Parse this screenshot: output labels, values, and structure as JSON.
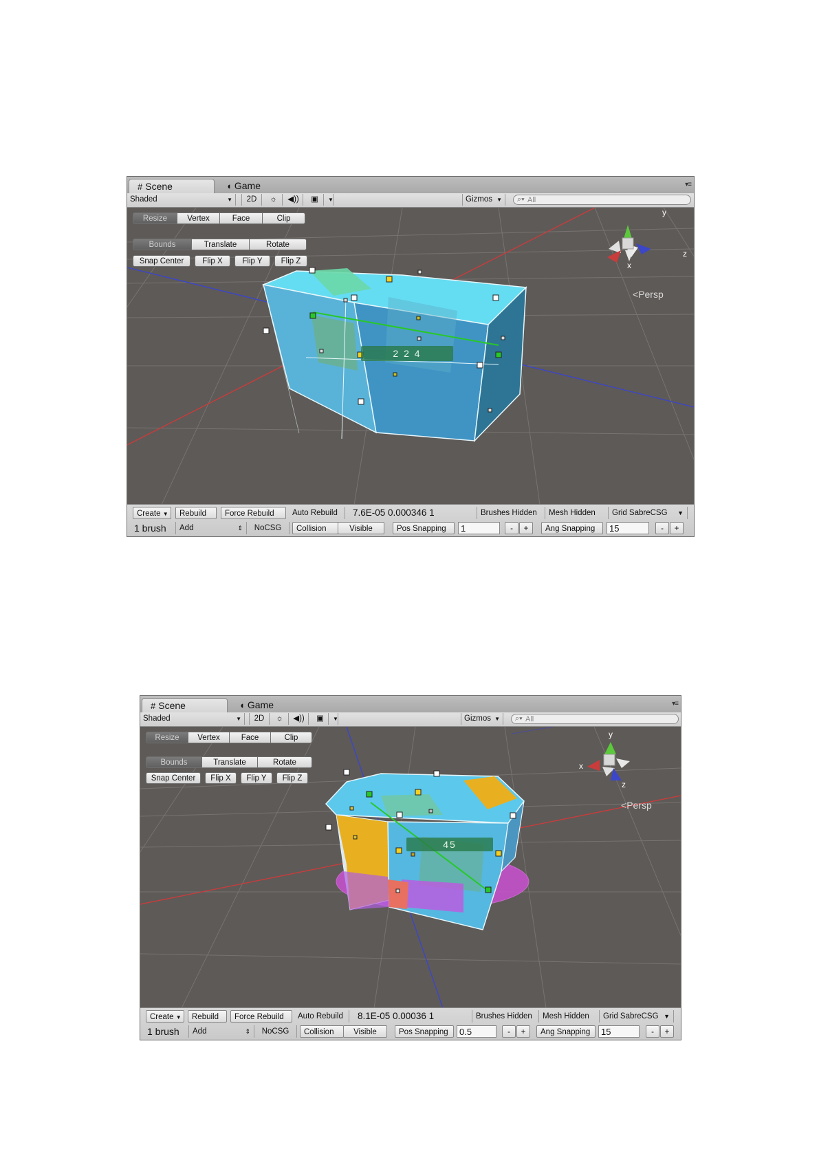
{
  "panels": [
    {
      "tabs": {
        "scene": "Scene",
        "game": "Game"
      },
      "toolbar": {
        "shading": "Shaded",
        "mode2d": "2D",
        "gizmos": "Gizmos",
        "search_placeholder": "All"
      },
      "modes": [
        "Resize",
        "Vertex",
        "Face",
        "Clip"
      ],
      "resize_modes": [
        "Bounds",
        "Translate",
        "Rotate"
      ],
      "actions": [
        "Snap Center",
        "Flip X",
        "Flip Y",
        "Flip Z"
      ],
      "gizmo_axes": {
        "x": "x",
        "y": "y",
        "z": "z"
      },
      "persp": "Persp",
      "dimension_label": "2 2 4",
      "bottom": {
        "create": "Create",
        "rebuild": "Rebuild",
        "force_rebuild": "Force Rebuild",
        "auto_rebuild": "Auto Rebuild",
        "stats": "7.6E-05 0.000346 1",
        "brushes_hidden": "Brushes Hidden",
        "mesh_hidden": "Mesh Hidden",
        "grid": "Grid SabreCSG",
        "brush_count": "1 brush",
        "operation": "Add",
        "nocsg": "NoCSG",
        "collision": "Collision",
        "visible": "Visible",
        "pos_snapping": "Pos Snapping",
        "pos_value": "1",
        "ang_snapping": "Ang Snapping",
        "ang_value": "15",
        "minus": "-",
        "plus": "+"
      }
    },
    {
      "tabs": {
        "scene": "Scene",
        "game": "Game"
      },
      "toolbar": {
        "shading": "Shaded",
        "mode2d": "2D",
        "gizmos": "Gizmos",
        "search_placeholder": "All"
      },
      "modes": [
        "Resize",
        "Vertex",
        "Face",
        "Clip"
      ],
      "resize_modes": [
        "Bounds",
        "Translate",
        "Rotate"
      ],
      "actions": [
        "Snap Center",
        "Flip X",
        "Flip Y",
        "Flip Z"
      ],
      "gizmo_axes": {
        "x": "x",
        "y": "y",
        "z": "z"
      },
      "persp": "Persp",
      "dimension_label": "45",
      "bottom": {
        "create": "Create",
        "rebuild": "Rebuild",
        "force_rebuild": "Force Rebuild",
        "auto_rebuild": "Auto Rebuild",
        "stats": "8.1E-05 0.00036 1",
        "brushes_hidden": "Brushes Hidden",
        "mesh_hidden": "Mesh Hidden",
        "grid": "Grid SabreCSG",
        "brush_count": "1 brush",
        "operation": "Add",
        "nocsg": "NoCSG",
        "collision": "Collision",
        "visible": "Visible",
        "pos_snapping": "Pos Snapping",
        "pos_value": "0.5",
        "ang_snapping": "Ang Snapping",
        "ang_value": "15",
        "minus": "-",
        "plus": "+"
      }
    }
  ],
  "icons": {
    "scene_tab": "grid-hash-icon",
    "game_tab": "pacman-icon",
    "lighting": "sun-icon",
    "audio": "speaker-icon",
    "effects": "image-icon",
    "search": "magnifier-icon",
    "tab_menu": "menu-icon"
  },
  "colors": {
    "viewport_bg": "#5e5a57",
    "axis_x": "#c83c3c",
    "axis_z": "#3c46c8",
    "axis_y": "#5cc83c",
    "brush_cyan": "#5fd0f0",
    "brush_blue": "#3b95c8",
    "brush_orange": "#e8b020",
    "rotation_circle": "#d040d0",
    "handle_white": "#ffffff",
    "handle_yellow": "#f5d020",
    "handle_green": "#28c828"
  }
}
